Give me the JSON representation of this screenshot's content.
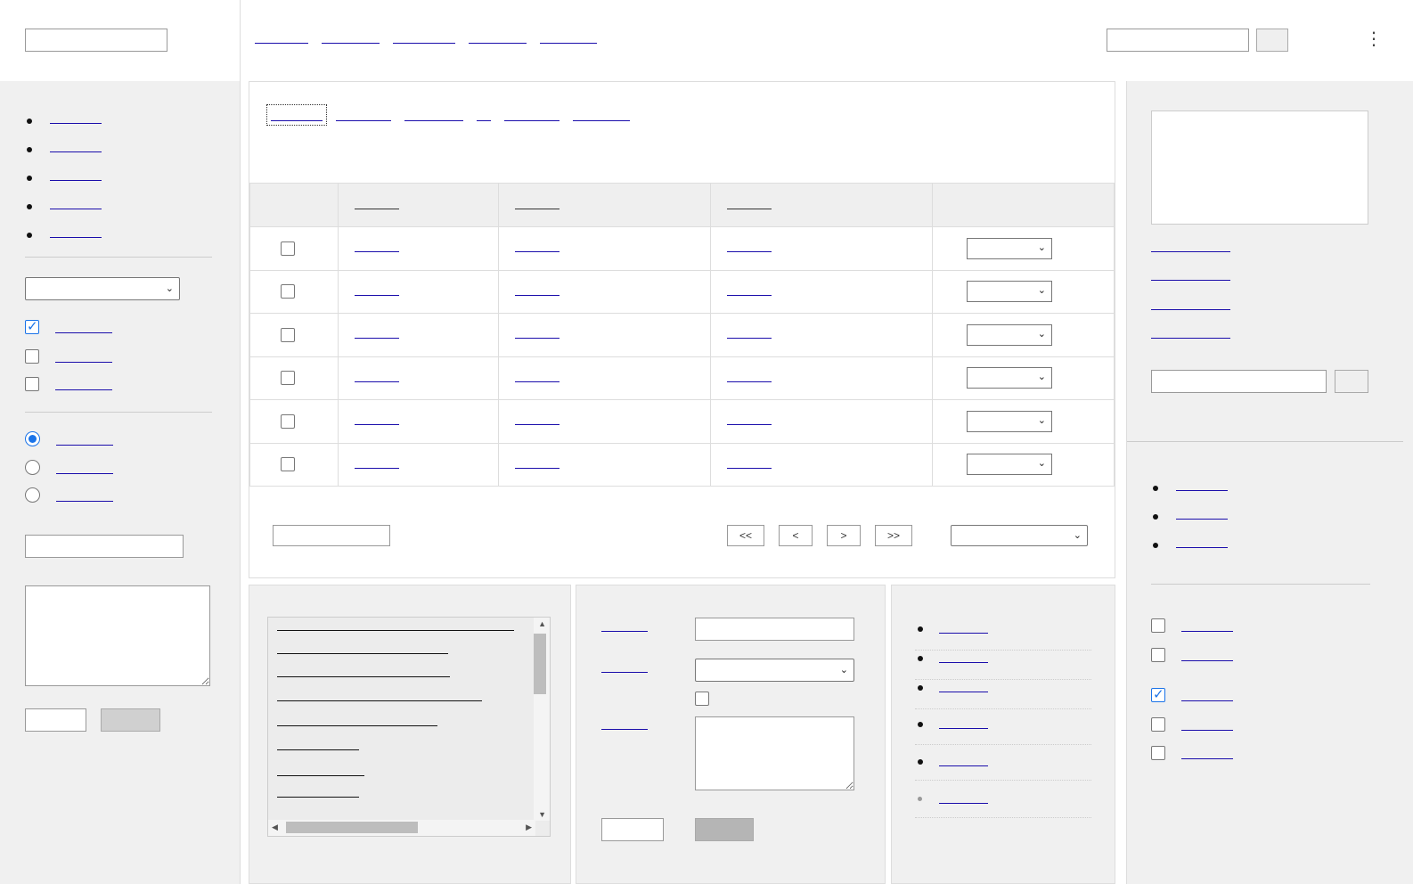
{
  "header": {
    "left_field_value": "",
    "nav": [
      "",
      "",
      "",
      "",
      ""
    ],
    "search_value": "",
    "search_button_label": "",
    "menu_icon": "⋮"
  },
  "sidebar": {
    "links": [
      "",
      "",
      "",
      "",
      ""
    ],
    "select_value": "",
    "checkboxes": [
      {
        "label": "",
        "checked": true
      },
      {
        "label": "",
        "checked": false
      },
      {
        "label": "",
        "checked": false
      }
    ],
    "radios": [
      {
        "label": "",
        "selected": true
      },
      {
        "label": "",
        "selected": false
      },
      {
        "label": "",
        "selected": false
      }
    ],
    "text_input_value": "",
    "textarea_value": "",
    "button_primary_label": "",
    "button_secondary_label": ""
  },
  "main": {
    "tabs": [
      "",
      "",
      "",
      "",
      "",
      ""
    ],
    "table": {
      "headers": [
        "",
        "",
        "",
        "",
        ""
      ],
      "rows": [
        {
          "c1": "",
          "c2": "",
          "c3": "",
          "select": ""
        },
        {
          "c1": "",
          "c2": "",
          "c3": "",
          "select": ""
        },
        {
          "c1": "",
          "c2": "",
          "c3": "",
          "select": ""
        },
        {
          "c1": "",
          "c2": "",
          "c3": "",
          "select": ""
        },
        {
          "c1": "",
          "c2": "",
          "c3": "",
          "select": ""
        },
        {
          "c1": "",
          "c2": "",
          "c3": "",
          "select": ""
        }
      ]
    },
    "pagination": {
      "input_value": "",
      "first": "<<",
      "prev": "<",
      "next": ">",
      "last": ">>",
      "per_page_value": ""
    }
  },
  "bottom": {
    "list_panel": {
      "lines": 8
    },
    "form": {
      "labels": [
        "",
        "",
        ""
      ],
      "text_value": "",
      "select_value": "",
      "textarea_value": "",
      "submit_label": "",
      "cancel_label": ""
    },
    "link_list": [
      "",
      "",
      "",
      "",
      "",
      ""
    ]
  },
  "right_sidebar": {
    "links": [
      "",
      "",
      "",
      ""
    ],
    "search_value": "",
    "search_button_label": "",
    "bullet_links": [
      "",
      "",
      ""
    ],
    "checkboxes": [
      {
        "label": "",
        "checked": false
      },
      {
        "label": "",
        "checked": false
      },
      {
        "label": "",
        "checked": true
      },
      {
        "label": "",
        "checked": false
      },
      {
        "label": "",
        "checked": false
      }
    ]
  },
  "colors": {
    "link": "#1a0dab",
    "accent": "#1a73e8",
    "panel_bg": "#f0f0f0",
    "border": "#dddddd"
  }
}
